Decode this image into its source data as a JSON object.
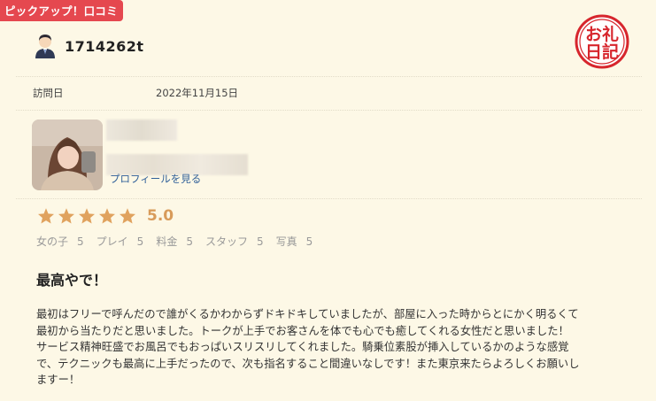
{
  "badge": "ピックアップ！口コミ",
  "user": {
    "name": "1714262t",
    "avatar_icon": "user-avatar-icon"
  },
  "stamp": {
    "line1": "お礼",
    "line2": "日記",
    "color": "#d7262d"
  },
  "visit": {
    "label": "訪問日",
    "date": "2022年11月15日"
  },
  "profile": {
    "link_label": "プロフィールを見る"
  },
  "rating": {
    "stars": 5,
    "max": 5,
    "score": "5.0",
    "star_color": "#e0a25e",
    "categories": [
      {
        "label": "女の子",
        "value": "5"
      },
      {
        "label": "プレイ",
        "value": "5"
      },
      {
        "label": "料金",
        "value": "5"
      },
      {
        "label": "スタッフ",
        "value": "5"
      },
      {
        "label": "写真",
        "value": "5"
      }
    ]
  },
  "review": {
    "title": "最高やで！",
    "lines": [
      "最初はフリーで呼んだので誰がくるかわからずドキドキしていましたが、部屋に入った時からとにかく明るくて",
      "最初から当たりだと思いました。トークが上手でお客さんを体でも心でも癒してくれる女性だと思いました！",
      "サービス精神旺盛でお風呂でもおっぱいスリスリしてくれました。騎乗位素股が挿入しているかのような感覚",
      "で、テクニックも最高に上手だったので、次も指名すること間違いなしです！また東京来たらよろしくお願いし",
      "ますー！"
    ]
  }
}
